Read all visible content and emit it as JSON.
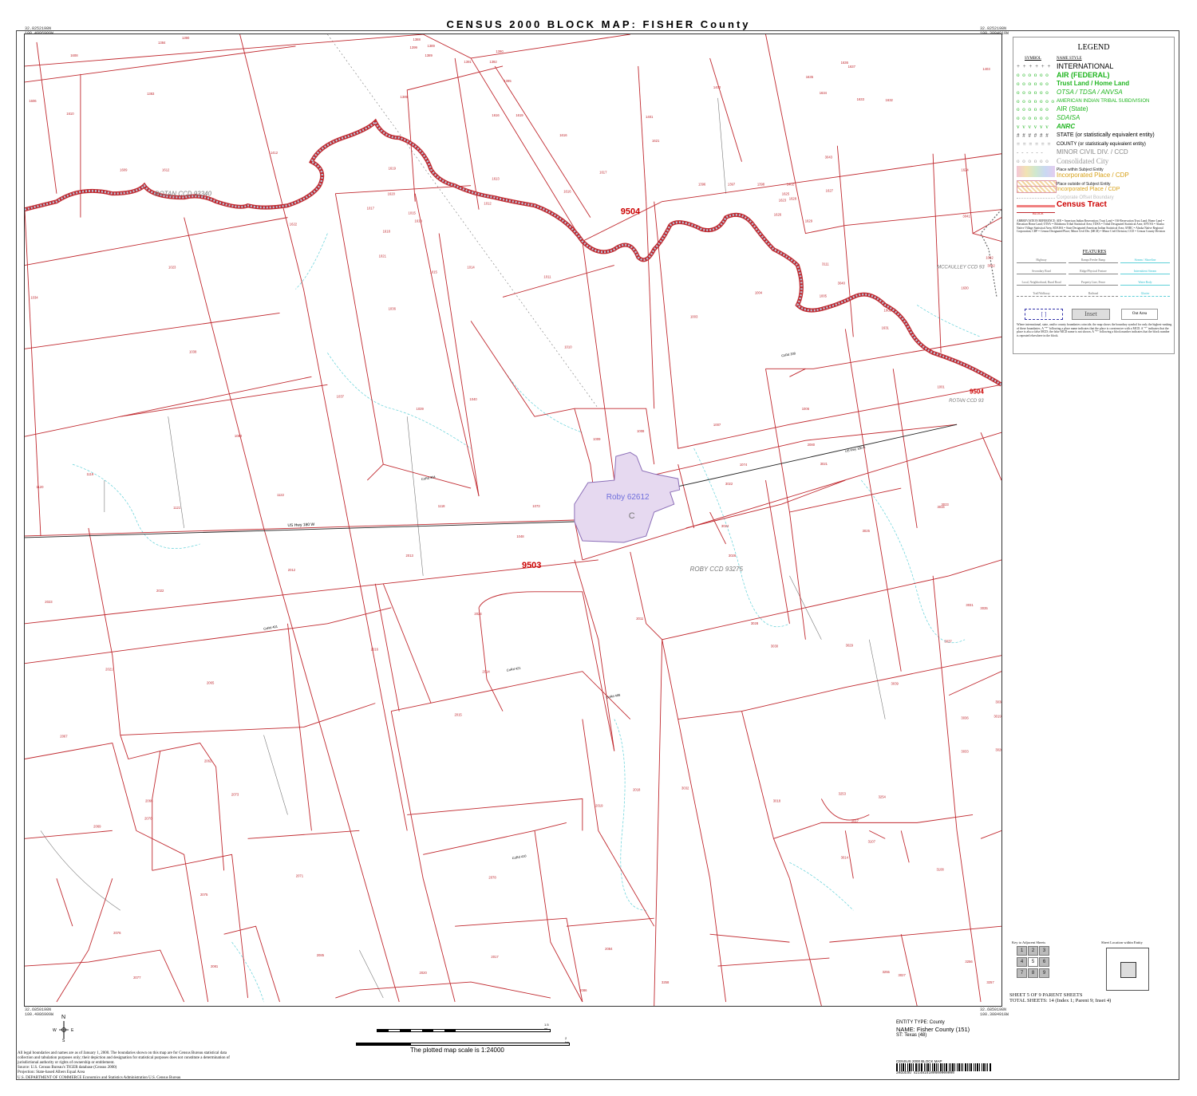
{
  "title": "CENSUS 2000 BLOCK MAP: FISHER County",
  "corner_coords": {
    "top_left": "32.8252198N\n100.4986909W",
    "top_right": "32.8252198N\n100.3084910W",
    "bottom_left": "32.6850198N\n100.4986909W",
    "bottom_right": "32.6850198N\n100.3084910W"
  },
  "map": {
    "ccd_labels": [
      "ROTAN CCD 93340",
      "ROBY CCD 93275",
      "MCCAULLEY CCD 93",
      "ROTAN CCD 93"
    ],
    "tract_labels": [
      "9504",
      "9503",
      "9504"
    ],
    "place_name": "Roby 62612",
    "place_code": "C",
    "roads": [
      "US Hwy 180 W",
      "US Hwy 180 E",
      "CoRd 208",
      "CoRd 304",
      "CoRd 401",
      "CoRd 421",
      "CoRd 410",
      "CoRd 406"
    ],
    "block_numbers": [
      "1384",
      "1388",
      "1399",
      "1608",
      "1606",
      "1389",
      "1389",
      "1390",
      "1390",
      "1392",
      "1391",
      "1395",
      "1610",
      "1383",
      "1412",
      "1389",
      "1616",
      "1619",
      "1616",
      "1612",
      "1619",
      "1613",
      "1620",
      "1012",
      "1015",
      "1017",
      "1617",
      "1618",
      "1618",
      "1616",
      "1609",
      "1624",
      "1622",
      "1023",
      "1021",
      "1011",
      "1034",
      "1014",
      "1015",
      "1036",
      "1038",
      "1037",
      "1040",
      "1039",
      "1010",
      "1009",
      "1008",
      "1007",
      "1006",
      "1003",
      "1004",
      "1005",
      "1062",
      "1002",
      "1001",
      "1080",
      "1119",
      "1120",
      "1121",
      "1122",
      "1118",
      "1073",
      "1074",
      "1048",
      "2013",
      "2012",
      "2022",
      "2023",
      "2024",
      "2011",
      "2016",
      "2021",
      "2014",
      "2015",
      "2065",
      "2067",
      "2062",
      "2073",
      "2070",
      "2069",
      "2066",
      "2071",
      "2075",
      "2076",
      "2077",
      "2078",
      "2019",
      "2018",
      "2017",
      "2020",
      "2084",
      "2086",
      "2085",
      "2081",
      "2080",
      "3021",
      "3022",
      "3023",
      "3024",
      "3025",
      "3026",
      "3028",
      "3029",
      "3030",
      "3031",
      "3032",
      "3033",
      "3034",
      "3035",
      "3036",
      "3037",
      "3038",
      "3039",
      "3019",
      "3020",
      "3014",
      "3017",
      "3018",
      "3253",
      "3254",
      "3255",
      "3256",
      "3257",
      "3258",
      "3111",
      "3107",
      "3108",
      "3027",
      "3040",
      "3041",
      "3042",
      "3043",
      "1627",
      "1628",
      "1629",
      "1630",
      "1631",
      "1632",
      "1633",
      "1634",
      "1635",
      "1636",
      "1637",
      "1623",
      "1625",
      "1626",
      "1621",
      "1403",
      "1400",
      "1401",
      "1396",
      "1397",
      "1398",
      "1402"
    ]
  },
  "legend": {
    "heading": "LEGEND",
    "symbol_header": "SYMBOL",
    "name_header": "NAME STYLE",
    "items": [
      {
        "sym": "+ + + + + +",
        "name": "INTERNATIONAL",
        "color": "#000000",
        "size": 9,
        "style": "normal"
      },
      {
        "sym": "o o o o o o",
        "name": "AIR (FEDERAL)",
        "color": "#1fb51f",
        "size": 9,
        "style": "bold"
      },
      {
        "sym": "o o o o o o",
        "name": "Trust Land / Home Land",
        "color": "#1fb51f",
        "size": 8,
        "style": "bold"
      },
      {
        "sym": "o o o o o o",
        "name": "OTSA / TDSA / ANVSA",
        "color": "#1fb51f",
        "size": 8,
        "style": "italic"
      },
      {
        "sym": "o o o o o o o",
        "name": "AMERICAN INDIAN TRIBAL SUBDIVISION",
        "color": "#1fb51f",
        "size": 6,
        "style": "normal"
      },
      {
        "sym": "o o o o o o",
        "name": "AIR (State)",
        "color": "#1fb51f",
        "size": 8,
        "style": "normal"
      },
      {
        "sym": "o o o o o o",
        "name": "SDAISA",
        "color": "#1fb51f",
        "size": 8,
        "style": "italic"
      },
      {
        "sym": "v v v v v v",
        "name": "ANRC",
        "color": "#1fb51f",
        "size": 8,
        "style": "bold-italic"
      },
      {
        "sym": "# # # # # #",
        "name": "STATE (or statistically equivalent entity)",
        "color": "#000000",
        "size": 7,
        "style": "normal"
      },
      {
        "sym": "= = = = = =",
        "name": "COUNTY (or statistically equivalent entity)",
        "color": "#000000",
        "size": 6,
        "style": "normal"
      },
      {
        "sym": "- - - - - -",
        "name": "MINOR CIVIL DIV. / CCD",
        "color": "#888888",
        "size": 8,
        "style": "normal"
      },
      {
        "sym": "o o o o o o",
        "name": "Consolidated City",
        "color": "#999999",
        "size": 9,
        "style": "serif"
      },
      {
        "sym": "",
        "name": "Place within Subject Entity",
        "color": "#222222",
        "size": 5,
        "style": "normal"
      },
      {
        "sym": "",
        "name": "Incorporated Place / CDP",
        "color": "#d8a21b",
        "size": 8,
        "style": "normal"
      },
      {
        "sym": "",
        "name": "Place outside of Subject Entity",
        "color": "#222222",
        "size": 5,
        "style": "normal"
      },
      {
        "sym": "",
        "name": "Incorporated Place / CDP",
        "color": "#d8a21b",
        "size": 7,
        "style": "normal"
      },
      {
        "sym": "",
        "name": "Corporate Offset Boundary",
        "color": "#bbbbbb",
        "size": 6,
        "style": "normal"
      },
      {
        "sym": "",
        "name": "Census Tract",
        "color": "#cc0000",
        "size": 10,
        "style": "bold"
      },
      {
        "sym": "",
        "name": "BLOCK",
        "color": "#cc0000",
        "size": 4,
        "style": "normal"
      }
    ],
    "abbrev_note": "ABBREVIATION REFERENCE: AIR = American Indian Reservation; Trust Land = Off-Reservation Trust Land; Home Land = Hawaiian Home Land; OTSA = Oklahoma Tribal Statistical Area; TDSA = Tribal Designated Statistical Area; ANVSA = Alaska Native Village Statistical Area; SDAISA = State Designated American Indian Statistical Area; ANRC = Alaska Native Regional Corporation; CDP = Census Designated Place; Minor Civil Div. (MCD) = Minor Civil Division; CCD = Census County Division",
    "features_header": "FEATURES",
    "features": [
      "Highway",
      "Ramps/Feeder Ramp",
      "Stream / Shoreline",
      "Secondary Road",
      "Ridge/Physical Feature",
      "Intermittent Stream",
      "Local, Neighborhood, Rural Road",
      "Property Line, Fence",
      "Water Body",
      "Trail/Walkway",
      "Railroad",
      "Glacier"
    ],
    "inset_box1": "",
    "inset_box2": "Inset",
    "inset_box3": "Out Area",
    "footnote": "Where international, state, and/or county boundaries coincide, the map shows the boundary symbol for only the highest-ranking of these boundaries. A \"*\" following a place name indicates that the place is coextensive with a MCD. A \"°\" indicates that the place is also a false MCD; the false MCD name is not shown. A \"*\" following a block number indicates that the block number is repeated elsewhere in the block."
  },
  "key_adjacent": {
    "label": "Key to Adjacent Sheets",
    "cells": [
      "1",
      "2",
      "3",
      "4",
      "5",
      "6",
      "7",
      "8",
      "9"
    ]
  },
  "sheet_location": {
    "label": "Sheet Location within Entity"
  },
  "sheet_info": {
    "line1": "SHEET 5 OF 9 PARENT SHEETS",
    "line2": "TOTAL SHEETS: 14 (Index 1; Parent 9; Inset 4)"
  },
  "entity": {
    "type": "ENTITY TYPE: County",
    "name": "NAME: Fisher County (151)",
    "state": "ST: Texas (48)"
  },
  "scale": {
    "text": "The plotted map scale is 1:24000",
    "top_unit": "1.5 mi",
    "bottom_unit": "2 km"
  },
  "disclaimer": "All legal boundaries and names are as of January 1, 2000. The boundaries shown on this map are for Census Bureau statistical data collection and tabulation purposes only; their depiction and designation for statistical purposes does not constitute a determination of jurisdictional authority or rights of ownership or entitlement.",
  "source": "Source: U.S. Census Bureau's TIGER database (Census 2000)",
  "projection": "Projection: State-based Albers Equal Area",
  "agency": "U.S. DEPARTMENT OF COMMERCE Economics and Statistics Administration U.S. Census Bureau",
  "barcode_label": "CENSUS 2000 BLOCK MAP",
  "barcode_code": "2KGUCOU 4214815100500000000",
  "compass": {
    "n": "N",
    "s": "S",
    "e": "E",
    "w": "W"
  }
}
